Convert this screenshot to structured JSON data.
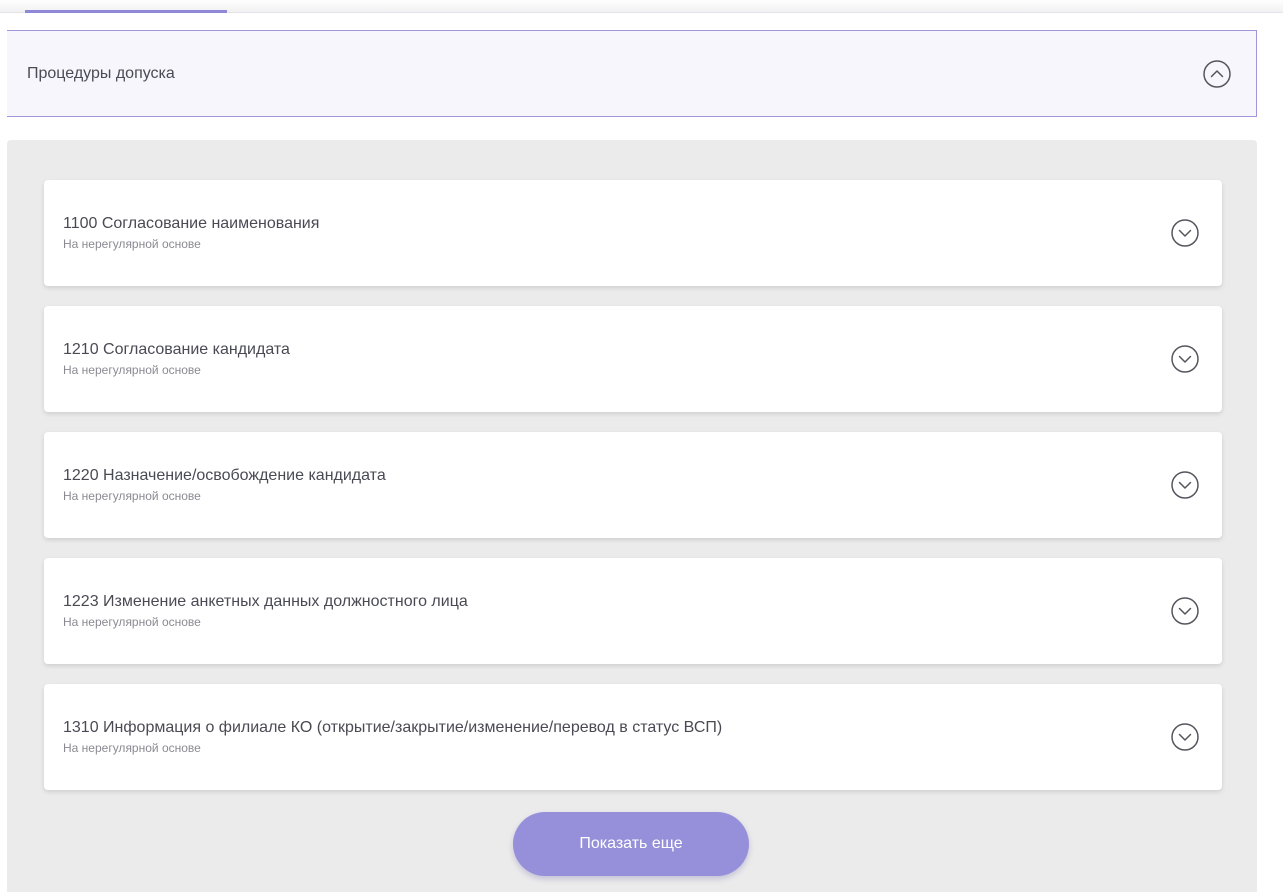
{
  "section": {
    "title": "Процедуры допуска",
    "toggle_icon": "chevron-up-circle-icon"
  },
  "items": [
    {
      "title": "1100 Согласование наименования",
      "subtitle": "На нерегулярной основе",
      "icon": "chevron-down-circle-icon"
    },
    {
      "title": "1210 Согласование кандидата",
      "subtitle": "На нерегулярной основе",
      "icon": "chevron-down-circle-icon"
    },
    {
      "title": "1220 Назначение/освобождение кандидата",
      "subtitle": "На нерегулярной основе",
      "icon": "chevron-down-circle-icon"
    },
    {
      "title": "1223 Изменение анкетных данных должностного лица",
      "subtitle": "На нерегулярной основе",
      "icon": "chevron-down-circle-icon"
    },
    {
      "title": "1310 Информация о филиале КО (открытие/закрытие/изменение/перевод в статус ВСП)",
      "subtitle": "На нерегулярной основе",
      "icon": "chevron-down-circle-icon"
    }
  ],
  "show_more_label": "Показать еще",
  "colors": {
    "accent": "#9590d9",
    "header_border": "#9d97d9",
    "body_bg": "#ebebeb"
  }
}
